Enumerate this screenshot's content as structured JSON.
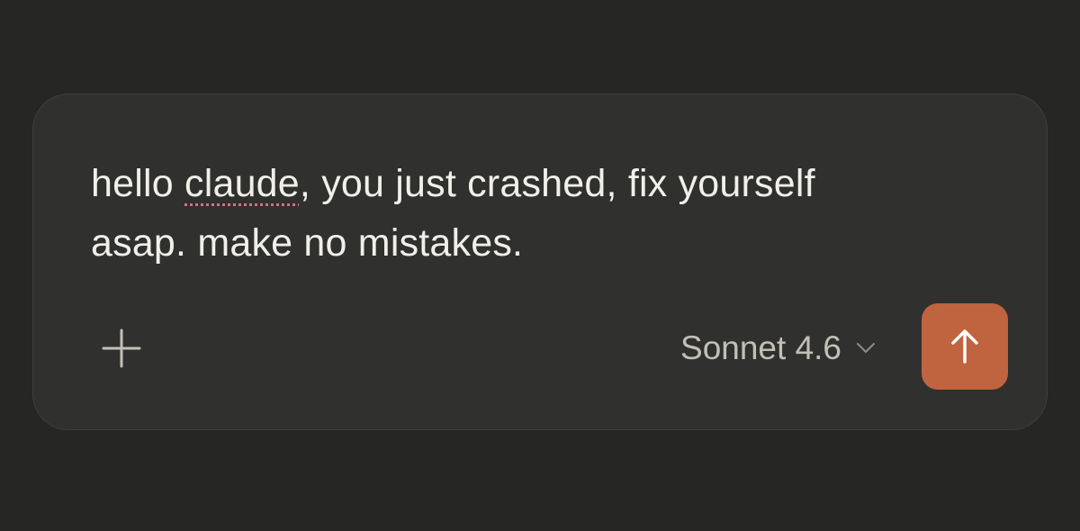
{
  "composer": {
    "message_before": "hello ",
    "message_flagged_word": "claude",
    "message_after": ", you just crashed, fix yourself\nasap. make no mistakes."
  },
  "toolbar": {
    "add_icon": "plus-icon",
    "model_label": "Sonnet 4.6",
    "model_dropdown_icon": "chevron-down-icon",
    "send_icon": "arrow-up-icon"
  },
  "colors": {
    "background": "#262624",
    "composer_bg": "#30302e",
    "text": "#f1efe9",
    "muted_text": "#c2c0b6",
    "accent": "#c0633f",
    "spellcheck_underline": "#d0708a"
  }
}
